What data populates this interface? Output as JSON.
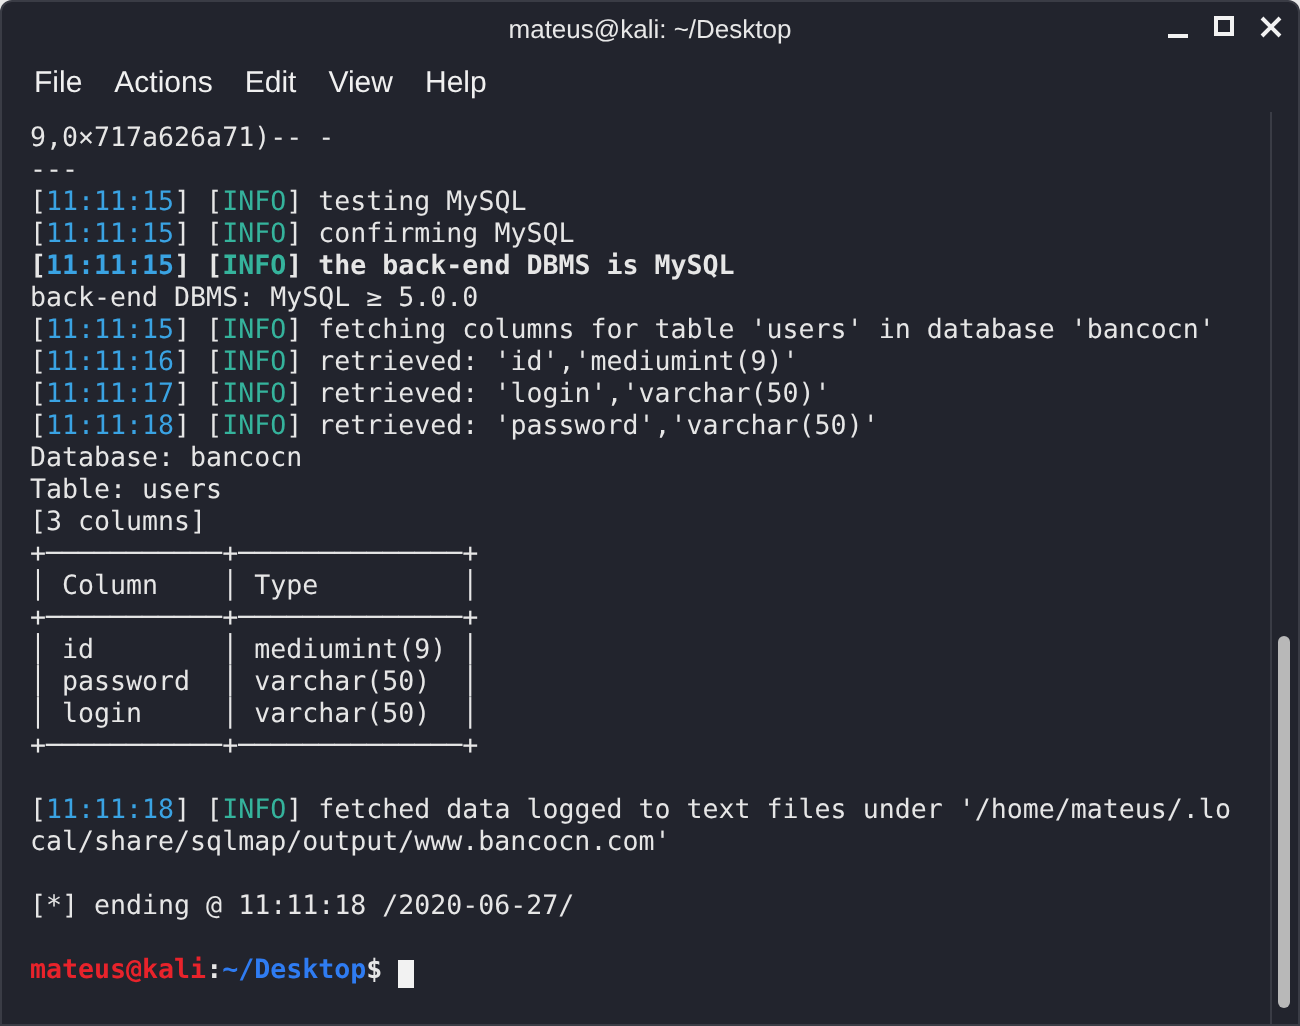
{
  "window": {
    "title": "mateus@kali: ~/Desktop"
  },
  "menu": [
    "File",
    "Actions",
    "Edit",
    "View",
    "Help"
  ],
  "terminal": {
    "lines": [
      {
        "kind": "plain",
        "text": "9,0×717a626a71)-- -"
      },
      {
        "kind": "plain",
        "text": "---"
      },
      {
        "kind": "log",
        "time_open": "[",
        "time": "11:11:15",
        "time_close": "]",
        "level_open": "[",
        "level": "INFO",
        "level_close": "]",
        "message": "testing MySQL",
        "bold": false
      },
      {
        "kind": "log",
        "time_open": "[",
        "time": "11:11:15",
        "time_close": "]",
        "level_open": "[",
        "level": "INFO",
        "level_close": "]",
        "message": "confirming MySQL",
        "bold": false
      },
      {
        "kind": "log",
        "time_open": "[",
        "time": "11:11:15",
        "time_close": "]",
        "level_open": "[",
        "level": "INFO",
        "level_close": "]",
        "message": "the back-end DBMS is MySQL",
        "bold": true
      },
      {
        "kind": "plain",
        "text": "back-end DBMS: MySQL ≥ 5.0.0"
      },
      {
        "kind": "log",
        "time_open": "[",
        "time": "11:11:15",
        "time_close": "]",
        "level_open": "[",
        "level": "INFO",
        "level_close": "]",
        "message": "fetching columns for table 'users' in database 'bancocn'",
        "bold": false
      },
      {
        "kind": "log",
        "time_open": "[",
        "time": "11:11:16",
        "time_close": "]",
        "level_open": "[",
        "level": "INFO",
        "level_close": "]",
        "message": "retrieved: 'id','mediumint(9)'",
        "bold": false
      },
      {
        "kind": "log",
        "time_open": "[",
        "time": "11:11:17",
        "time_close": "]",
        "level_open": "[",
        "level": "INFO",
        "level_close": "]",
        "message": "retrieved: 'login','varchar(50)'",
        "bold": false
      },
      {
        "kind": "log",
        "time_open": "[",
        "time": "11:11:18",
        "time_close": "]",
        "level_open": "[",
        "level": "INFO",
        "level_close": "]",
        "message": "retrieved: 'password','varchar(50)'",
        "bold": false
      },
      {
        "kind": "plain",
        "text": "Database: bancocn"
      },
      {
        "kind": "plain",
        "text": "Table: users"
      },
      {
        "kind": "plain",
        "text": "[3 columns]"
      },
      {
        "kind": "plain",
        "text": "+───────────+──────────────+"
      },
      {
        "kind": "plain",
        "text": "│ Column    │ Type         │"
      },
      {
        "kind": "plain",
        "text": "+───────────+──────────────+"
      },
      {
        "kind": "plain",
        "text": "│ id        │ mediumint(9) │"
      },
      {
        "kind": "plain",
        "text": "│ password  │ varchar(50)  │"
      },
      {
        "kind": "plain",
        "text": "│ login     │ varchar(50)  │"
      },
      {
        "kind": "plain",
        "text": "+───────────+──────────────+"
      },
      {
        "kind": "blank"
      },
      {
        "kind": "log",
        "time_open": "[",
        "time": "11:11:18",
        "time_close": "]",
        "level_open": "[",
        "level": "INFO",
        "level_close": "]",
        "message": "fetched data logged to text files under '/home/mateus/.lo",
        "bold": false
      },
      {
        "kind": "plain",
        "text": "cal/share/sqlmap/output/www.bancocn.com'"
      },
      {
        "kind": "blank"
      },
      {
        "kind": "plain",
        "text": "[*] ending @ 11:11:18 /2020-06-27/"
      },
      {
        "kind": "blank"
      },
      {
        "kind": "prompt",
        "user_host": "mateus@kali",
        "separator": ":",
        "path": "~/Desktop",
        "symbol": "$"
      }
    ]
  }
}
